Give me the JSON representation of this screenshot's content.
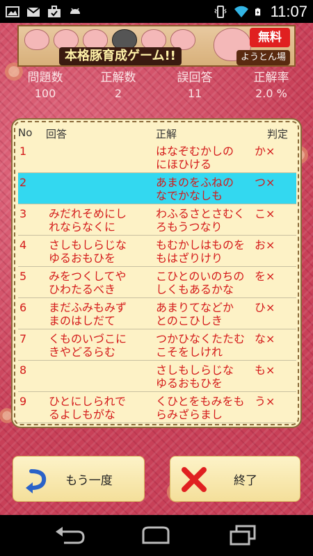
{
  "status_bar": {
    "time": "11:07",
    "left_icons": [
      "image-icon",
      "gmail-icon",
      "briefcase-icon",
      "android-icon"
    ],
    "right_icons": [
      "vibrate-icon",
      "wifi-icon",
      "battery-icon"
    ]
  },
  "banner": {
    "title": "本格豚育成ゲーム!!",
    "free_badge": "無料",
    "logo": "ようとん場"
  },
  "stats": [
    {
      "label": "問題数",
      "value": "100"
    },
    {
      "label": "正解数",
      "value": "2"
    },
    {
      "label": "誤回答",
      "value": "11"
    },
    {
      "label": "正解率",
      "value": "2.0 %"
    }
  ],
  "table": {
    "headers": {
      "no": "No",
      "answer": "回答",
      "correct": "正解",
      "result": "判定"
    },
    "rows": [
      {
        "no": "1",
        "answer": "",
        "correct": "はなぞむかしの\nにほひける",
        "result": "か×"
      },
      {
        "no": "2",
        "answer": "",
        "correct": "あまのをふねの\nなでかなしも",
        "result": "つ×"
      },
      {
        "no": "3",
        "answer": "みだれそめにし\nれならなくに",
        "correct": "わふるさとさむく\nろもうつなり",
        "result": "こ×"
      },
      {
        "no": "4",
        "answer": "さしもしらじな\nゆるおもひを",
        "correct": "もむかしはものを\nもはざりけり",
        "result": "お×"
      },
      {
        "no": "5",
        "answer": "みをつくしてや\nひわたるべき",
        "correct": "こひとのいのちの\nしくもあるかな",
        "result": "を×"
      },
      {
        "no": "6",
        "answer": "まだふみもみず\nまのはしだて",
        "correct": "あまりてなどか\nとのこひしき",
        "result": "ひ×"
      },
      {
        "no": "7",
        "answer": "くものいづこに\nきやどるらむ",
        "correct": "つかひなくたたむ\nこそをしけれ",
        "result": "な×"
      },
      {
        "no": "8",
        "answer": "",
        "correct": "さしもしらじな\nゆるおもひを",
        "result": "も×"
      },
      {
        "no": "9",
        "answer": "ひとにしられで\nるよしもがな",
        "correct": "くひとをもみをも\nらみざらまし",
        "result": "う×"
      }
    ],
    "selected_row": 2
  },
  "buttons": {
    "retry": "もう一度",
    "end": "終了"
  },
  "colors": {
    "accent_red": "#d41a1a",
    "selected_row": "#33d8f0",
    "panel_bg": "#fdf2c6",
    "button_bg": "#f4df9a"
  }
}
